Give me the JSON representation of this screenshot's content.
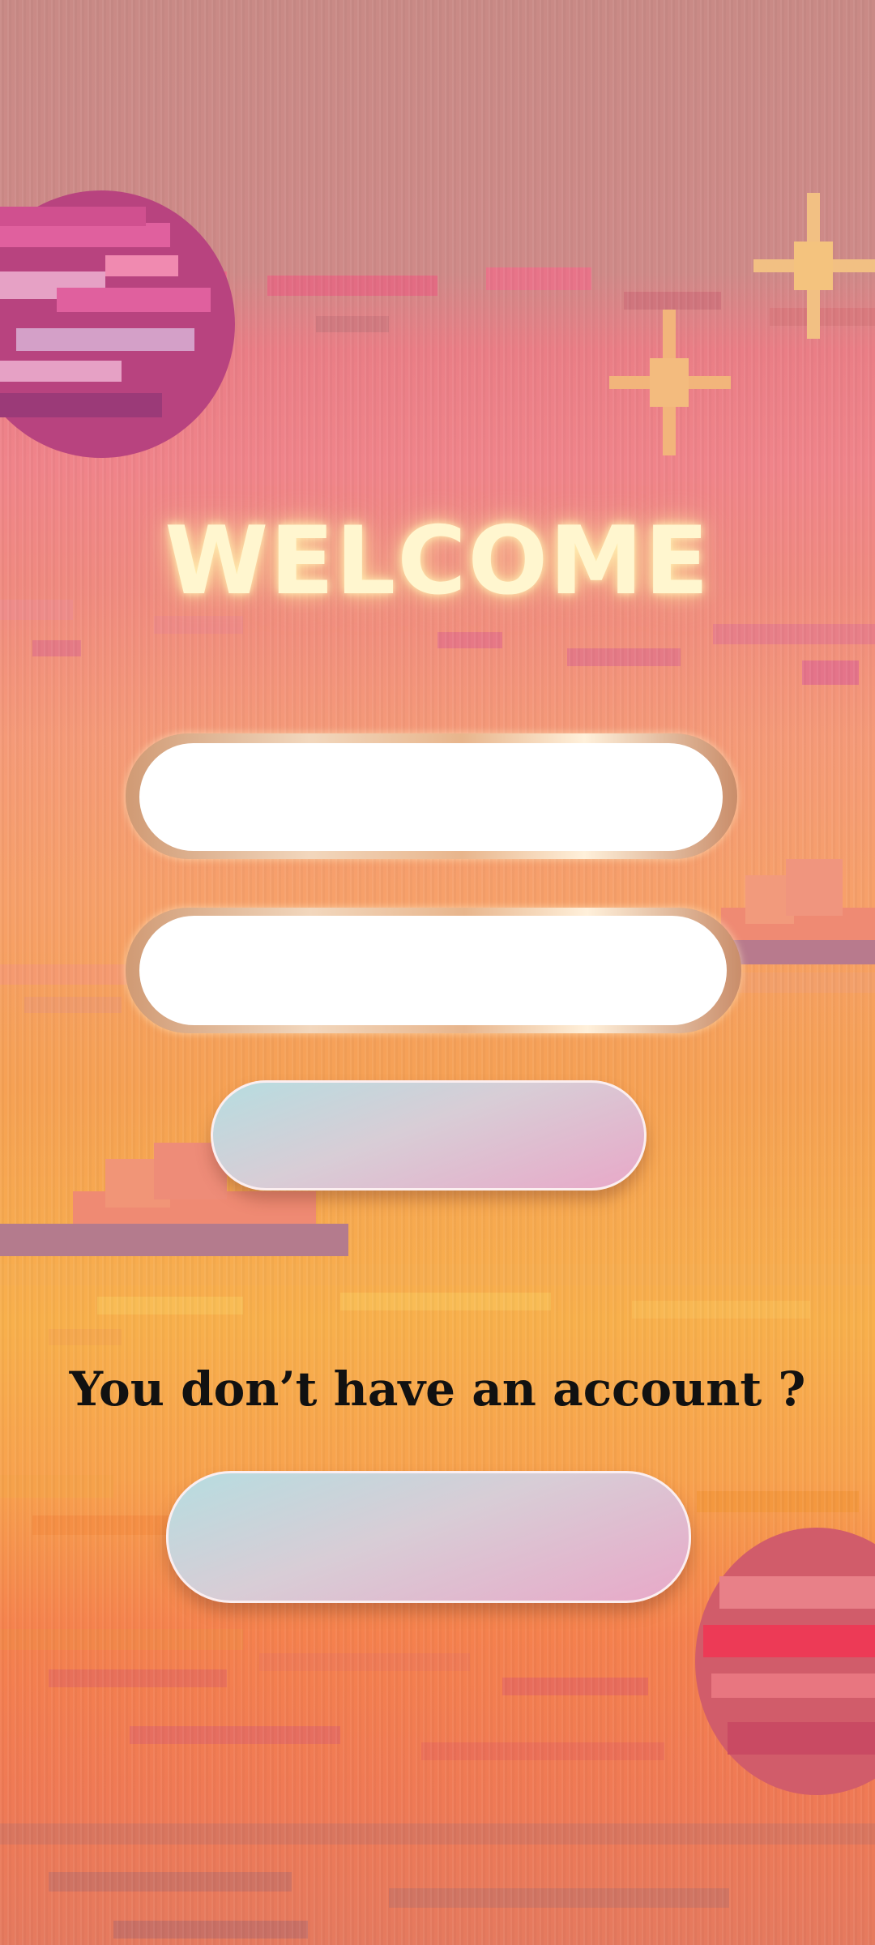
{
  "screen": {
    "title": "WELCOME",
    "question": "You don’t have an account ?"
  },
  "form": {
    "first_field": {
      "value": "",
      "placeholder": ""
    },
    "second_field": {
      "value": "",
      "placeholder": ""
    },
    "primary_button_label": "",
    "secondary_button_label": ""
  },
  "colors": {
    "title": "#fff6cf",
    "field": "#ffffff",
    "button_gradient_start": "#b6dde0",
    "button_gradient_end": "#e8a8c8",
    "question_text": "#111111"
  },
  "decorations": {
    "top_left": "pink-planet",
    "bottom_right": "red-planet",
    "sparkles": "star-sparkle",
    "clouds": "pixel-cloud"
  }
}
